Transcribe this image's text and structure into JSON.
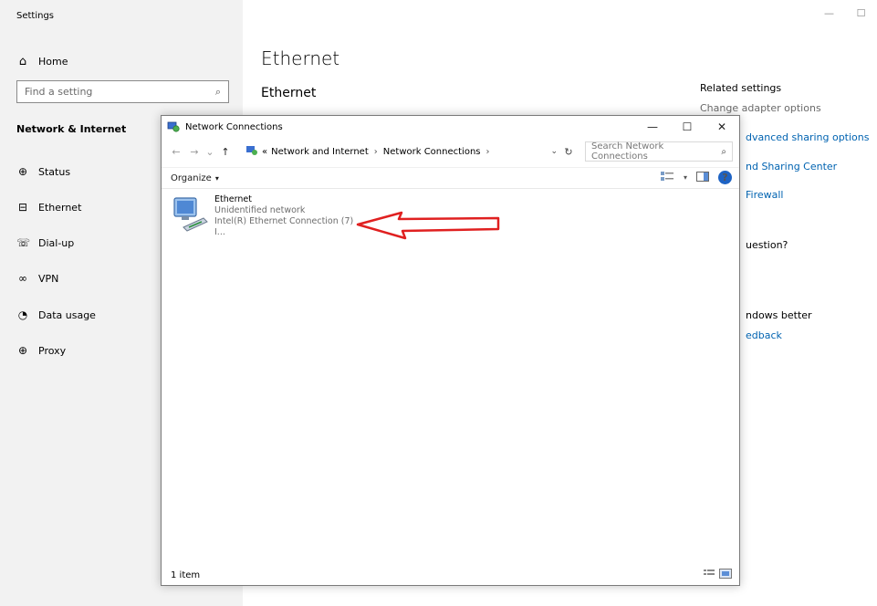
{
  "settings": {
    "title": "Settings",
    "home_label": "Home",
    "search_placeholder": "Find a setting",
    "section": "Network & Internet",
    "nav": [
      {
        "label": "Status"
      },
      {
        "label": "Ethernet"
      },
      {
        "label": "Dial-up"
      },
      {
        "label": "VPN"
      },
      {
        "label": "Data usage"
      },
      {
        "label": "Proxy"
      }
    ],
    "window_controls": {
      "minimize": "—",
      "maximize": "☐"
    }
  },
  "main": {
    "title": "Ethernet",
    "subtitle": "Ethernet",
    "related_title": "Related settings",
    "related_links": [
      "Change adapter options",
      "dvanced sharing options",
      "nd Sharing Center",
      "Firewall"
    ],
    "question_text": "uestion?",
    "feedback_heading": "ndows better",
    "feedback_link": "edback"
  },
  "network_connections": {
    "title": "Network Connections",
    "controls": {
      "minimize": "—",
      "maximize": "☐",
      "close": "✕"
    },
    "nav": {
      "back": "←",
      "forward": "→",
      "recent": "⌄",
      "up": "↑"
    },
    "breadcrumb": {
      "prefix": "«",
      "items": [
        "Network and Internet",
        "Network Connections"
      ],
      "sep": "›"
    },
    "address_dropdown": "⌄",
    "refresh": "↻",
    "search_placeholder": "Search Network Connections",
    "toolbar": {
      "organize": "Organize",
      "organize_caret": "▾",
      "view_caret": "▾",
      "help": "?"
    },
    "connection": {
      "name": "Ethernet",
      "status": "Unidentified network",
      "adapter": "Intel(R) Ethernet Connection (7) I..."
    },
    "status_bar": "1 item"
  },
  "annotation": {
    "arrow_color": "#e02020"
  }
}
